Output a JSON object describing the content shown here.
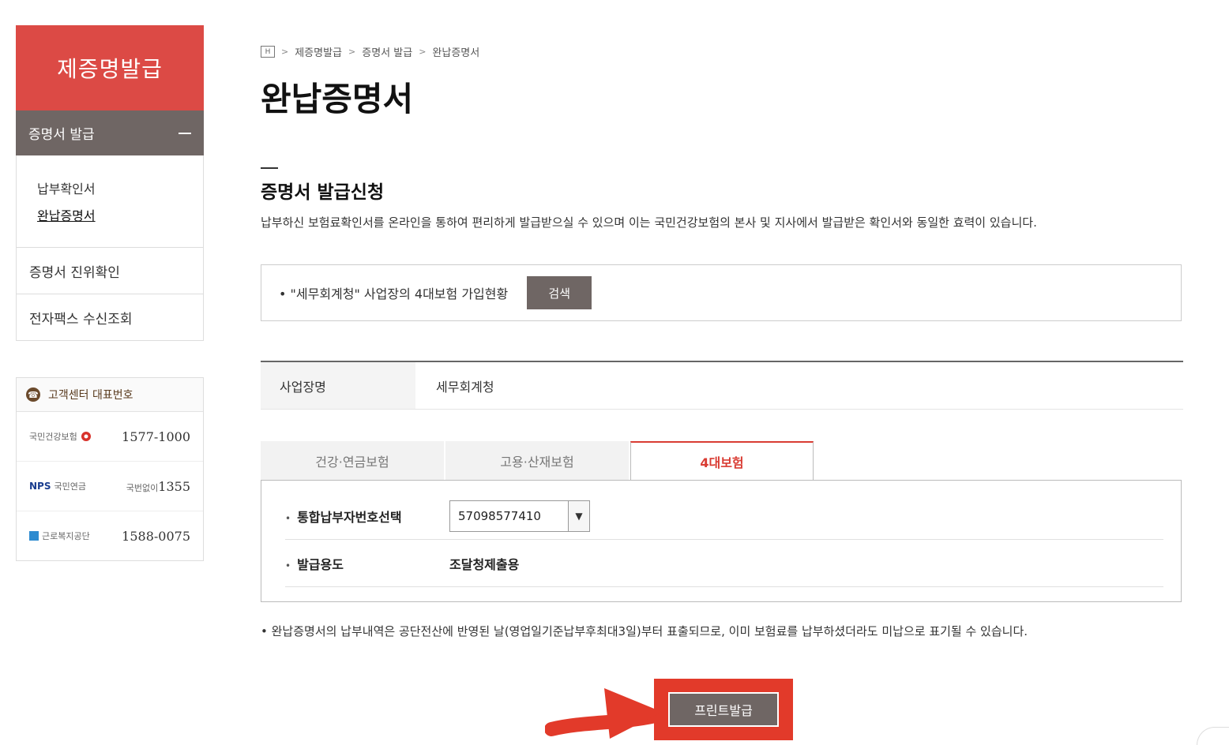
{
  "sidebar": {
    "title": "제증명발급",
    "section": "증명서 발급",
    "sub_items": [
      "납부확인서",
      "완납증명서"
    ],
    "links": [
      "증명서 진위확인",
      "전자팩스 수신조회"
    ]
  },
  "customer_center": {
    "title": "고객센터 대표번호",
    "rows": [
      {
        "org": "국민건강보험",
        "number": "1577-1000"
      },
      {
        "org": "국민연금",
        "number_prefix": "국번없이",
        "number": "1355"
      },
      {
        "org": "근로복지공단",
        "number": "1588-0075"
      }
    ]
  },
  "breadcrumb": [
    "제증명발급",
    "증명서 발급",
    "완납증명서"
  ],
  "page_title": "완납증명서",
  "section_title": "증명서 발급신청",
  "description": "납부하신 보험료확인서를 온라인을 통하여 편리하게 발급받으실 수 있으며 이는 국민건강보험의 본사 및 지사에서 발급받은 확인서와 동일한 효력이 있습니다.",
  "search": {
    "text": "• \"세무회계청\" 사업장의 4대보험 가입현황",
    "button": "검색"
  },
  "business": {
    "label": "사업장명",
    "value": "세무회계청"
  },
  "tabs": [
    "건강·연금보험",
    "고용·산재보험",
    "4대보험"
  ],
  "form": {
    "payer_label": "통합납부자번호선택",
    "payer_value": "57098577410",
    "purpose_label": "발급용도",
    "purpose_value": "조달청제출용"
  },
  "notice": "• 완납증명서의 납부내역은 공단전산에 반영된 날(영업일기준납부후최대3일)부터 표출되므로, 이미 보험료를 납부하셨더라도 미납으로 표기될 수 있습니다.",
  "print_button": "프린트발급",
  "colors": {
    "brand_red": "#dc4a45",
    "button_brown": "#6f6664",
    "highlight": "#e23a2a"
  }
}
